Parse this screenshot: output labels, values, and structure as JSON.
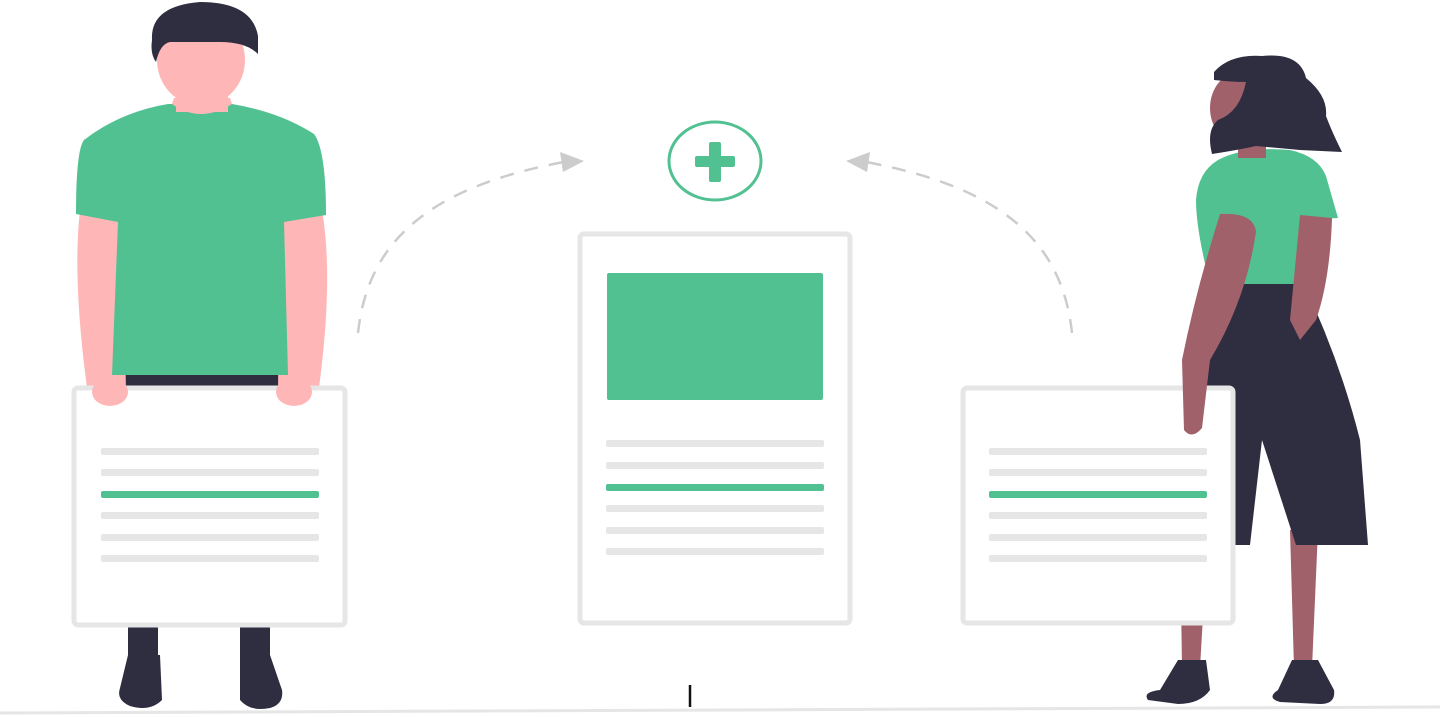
{
  "illustration": {
    "theme": "merge-documents",
    "colors": {
      "accent": "#52C191",
      "card_border": "#E6E6E6",
      "card_fill": "#FFFFFF",
      "line_gray": "#E6E6E6",
      "arrow": "#CCCCCC",
      "hair": "#2F2E41",
      "skin_light": "#FFB6B6",
      "skin_dark": "#A0616A",
      "dark_cloth": "#2F2E41",
      "ground": "#E6E6E6"
    },
    "icons": {
      "merge": "plus-circle-icon",
      "arrows": "dashed-curved-arrow-icon"
    },
    "documents": [
      {
        "role": "left-source",
        "line_count": 6,
        "highlighted_line": 3,
        "has_image_block": false
      },
      {
        "role": "merged-result",
        "line_count": 6,
        "highlighted_line": 3,
        "has_image_block": true
      },
      {
        "role": "right-source",
        "line_count": 6,
        "highlighted_line": 3,
        "has_image_block": false
      }
    ],
    "people": [
      {
        "role": "man-holding-document",
        "shirt_color": "#52C191"
      },
      {
        "role": "woman-holding-document",
        "shirt_color": "#52C191"
      }
    ]
  }
}
